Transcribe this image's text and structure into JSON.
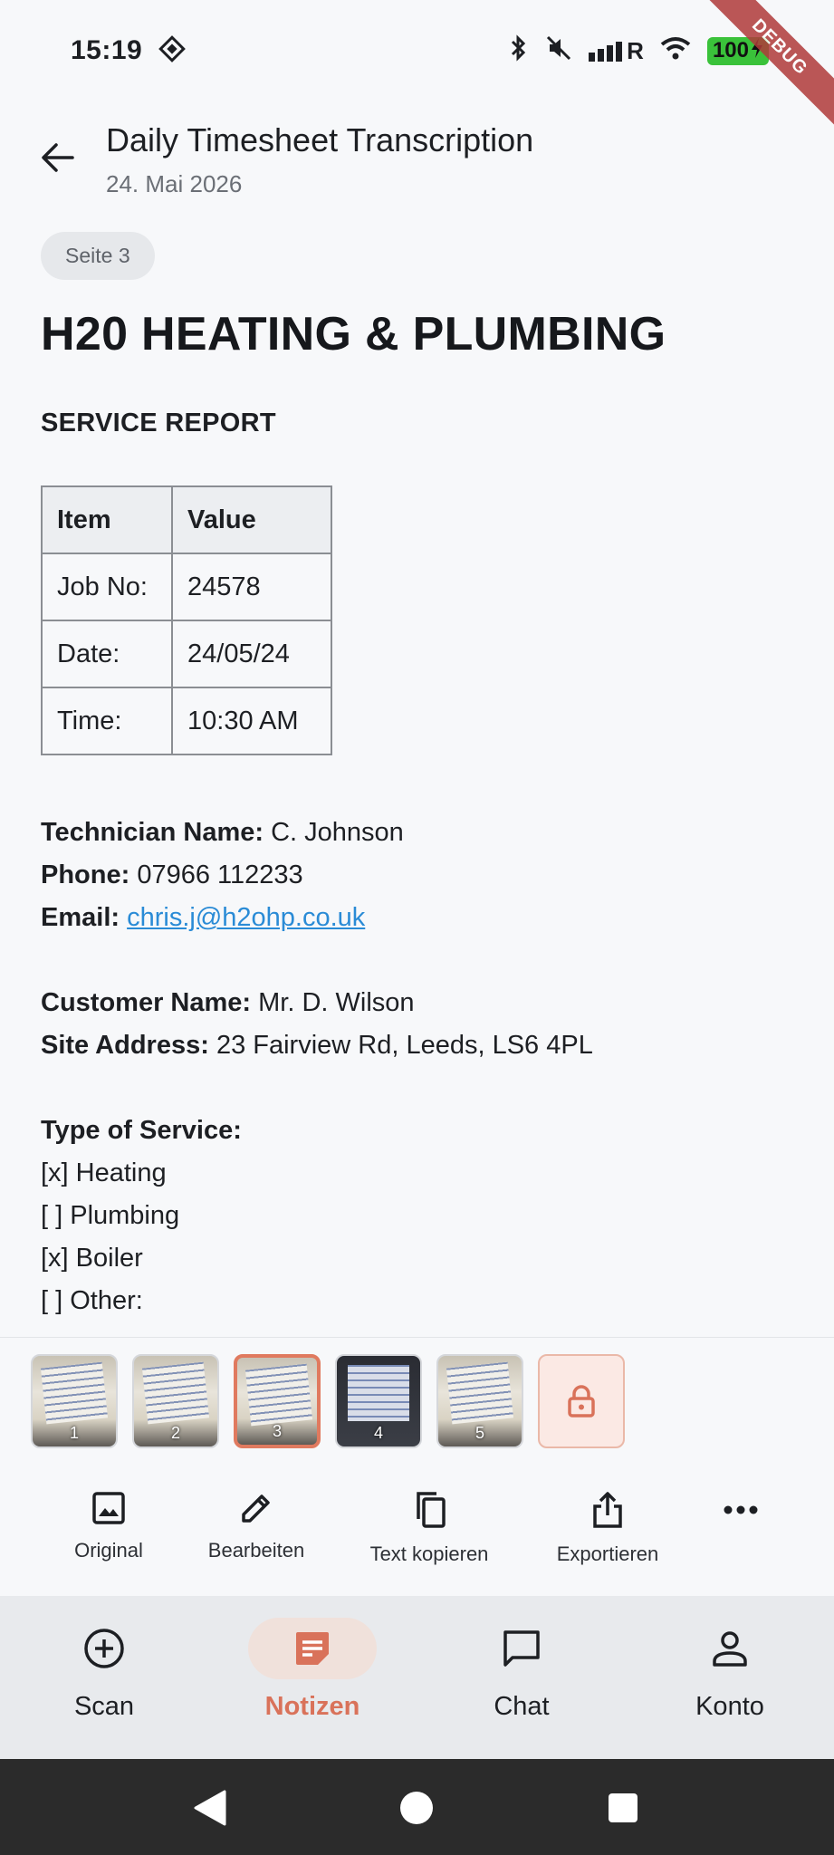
{
  "status_bar": {
    "time": "15:19",
    "battery": "100",
    "signal_label": "R",
    "debug_label": "DEBUG"
  },
  "header": {
    "title": "Daily Timesheet Transcription",
    "date": "24. Mai 2026"
  },
  "document": {
    "page_chip": "Seite 3",
    "heading": "H20 HEATING & PLUMBING",
    "subheading": "SERVICE REPORT",
    "table": {
      "headers": [
        "Item",
        "Value"
      ],
      "rows": [
        [
          "Job No:",
          "24578"
        ],
        [
          "Date:",
          "24/05/24"
        ],
        [
          "Time:",
          "10:30 AM"
        ]
      ]
    },
    "technician": {
      "label": "Technician Name:",
      "value": "C. Johnson"
    },
    "phone": {
      "label": "Phone:",
      "value": "07966 112233"
    },
    "email": {
      "label": "Email:",
      "value": "chris.j@h2ohp.co.uk"
    },
    "customer": {
      "label": "Customer Name:",
      "value": "Mr. D. Wilson"
    },
    "site": {
      "label": "Site Address:",
      "value": "23 Fairview Rd, Leeds, LS6 4PL"
    },
    "service_type": {
      "label": "Type of Service:",
      "options": [
        "[x] Heating",
        "[ ] Plumbing",
        "[x] Boiler",
        "[ ] Other:"
      ]
    }
  },
  "thumbnails": {
    "pages": [
      "1",
      "2",
      "3",
      "4",
      "5"
    ],
    "selected": "3"
  },
  "actions": {
    "original": "Original",
    "edit": "Bearbeiten",
    "copy_text": "Text kopieren",
    "export": "Exportieren"
  },
  "nav": {
    "scan": "Scan",
    "notes": "Notizen",
    "chat": "Chat",
    "account": "Konto"
  },
  "colors": {
    "accent": "#d9725a",
    "link": "#2a8bd6",
    "background": "#f7f8fa"
  }
}
